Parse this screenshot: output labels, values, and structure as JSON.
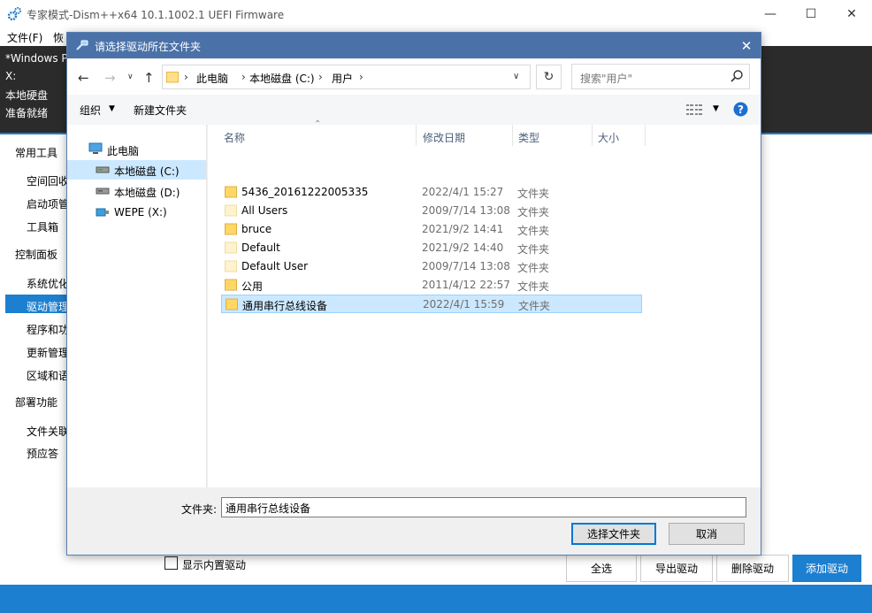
{
  "main_window": {
    "title": "专家模式-Dism++x64 10.1.1002.1 UEFI Firmware",
    "menu": [
      "文件(F)",
      "恢"
    ],
    "info_lines": [
      "*Windows P",
      "X:",
      "本地硬盘",
      "准备就绪"
    ],
    "nav": {
      "sections": [
        {
          "label": "常用工具",
          "items": [
            "空间回收",
            "启动项管",
            "工具箱"
          ]
        },
        {
          "label": "控制面板",
          "items": [
            "系统优化",
            "驱动管理",
            "程序和功",
            "更新管理",
            "区域和语"
          ]
        },
        {
          "label": "部署功能",
          "items": [
            "文件关联",
            "预应答"
          ]
        }
      ],
      "selected": "驱动管理"
    },
    "bottom": {
      "checkbox_label": "显示内置驱动",
      "buttons": [
        "全选",
        "导出驱动",
        "删除驱动",
        "添加驱动"
      ]
    },
    "accent_color": "#1d7fd0"
  },
  "dialog": {
    "title": "请选择驱动所在文件夹",
    "breadcrumb": [
      "此电脑",
      "本地磁盘 (C:)",
      "用户"
    ],
    "search_placeholder": "搜索\"用户\"",
    "toolbar": {
      "organize": "组织",
      "new_folder": "新建文件夹"
    },
    "tree": [
      {
        "label": "此电脑",
        "icon": "computer-icon"
      },
      {
        "label": "本地磁盘 (C:)",
        "icon": "drive-icon",
        "selected": true
      },
      {
        "label": "本地磁盘 (D:)",
        "icon": "drive-icon"
      },
      {
        "label": "WEPE (X:)",
        "icon": "usb-drive-icon"
      }
    ],
    "columns": [
      "名称",
      "修改日期",
      "类型",
      "大小"
    ],
    "files": [
      {
        "name": "5436_20161222005335",
        "date": "2022/4/1 15:27",
        "type": "文件夹"
      },
      {
        "name": "All Users",
        "date": "2009/7/14 13:08",
        "type": "文件夹",
        "faded": true
      },
      {
        "name": "bruce",
        "date": "2021/9/2 14:41",
        "type": "文件夹"
      },
      {
        "name": "Default",
        "date": "2021/9/2 14:40",
        "type": "文件夹",
        "faded": true
      },
      {
        "name": "Default User",
        "date": "2009/7/14 13:08",
        "type": "文件夹",
        "faded": true
      },
      {
        "name": "公用",
        "date": "2011/4/12 22:57",
        "type": "文件夹"
      },
      {
        "name": "通用串行总线设备",
        "date": "2022/4/1 15:59",
        "type": "文件夹",
        "selected": true
      }
    ],
    "folder_label": "文件夹:",
    "folder_value": "通用串行总线设备",
    "buttons": {
      "select": "选择文件夹",
      "cancel": "取消"
    }
  }
}
